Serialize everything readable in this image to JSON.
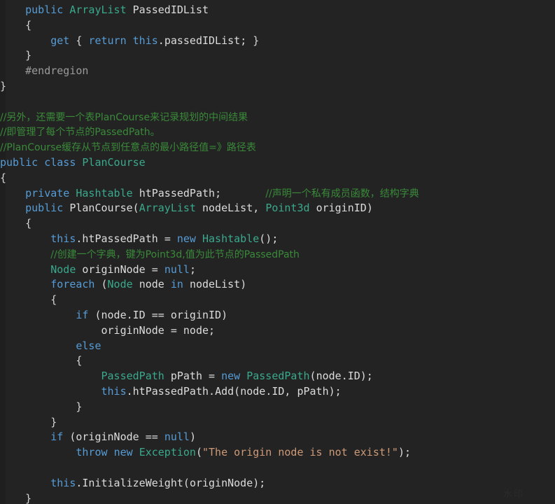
{
  "editor": {
    "background_color": "#232323",
    "gutter_color": "#1f1f1f",
    "default_text_color": "#dcdcdc",
    "language": "C#",
    "watermark": "水印"
  },
  "palette": {
    "keyword": "#569cd6",
    "type": "#3aa98c",
    "identifier": "#dcdcdc",
    "comment": "#3a8a3a",
    "preprocessor": "#9b9b9b",
    "string": "#cd9a78"
  },
  "code": {
    "lines": [
      "    public ArrayList PassedIDList",
      "    {",
      "        get { return this.passedIDList; }",
      "    }",
      "    #endregion",
      "}",
      "",
      "//另外，还需要一个表PlanCourse来记录规划的中间结果",
      "//即管理了每个节点的PassedPath。",
      "//PlanCourse缓存从节点到任意点的最小路径值=》路径表",
      "public class PlanCourse",
      "{",
      "    private Hashtable htPassedPath;      //声明一个私有成员函数，结构字典",
      "    public PlanCourse(ArrayList nodeList, Point3d originID)",
      "    {",
      "        this.htPassedPath = new Hashtable();",
      "        //创建一个字典，键为Point3d,值为此节点的PassedPath",
      "        Node originNode = null;",
      "        foreach (Node node in nodeList)",
      "        {",
      "            if (node.ID == originID)",
      "                originNode = node;",
      "            else",
      "            {",
      "                PassedPath pPath = new PassedPath(node.ID);",
      "                this.htPassedPath.Add(node.ID, pPath);",
      "            }",
      "        }",
      "        if (originNode == null)",
      "            throw new Exception(\"The origin node is not exist!\");",
      "",
      "        this.InitializeWeight(originNode);",
      "    }"
    ],
    "tokens": {
      "keywords": [
        "public",
        "private",
        "class",
        "get",
        "return",
        "this",
        "new",
        "null",
        "foreach",
        "in",
        "if",
        "else",
        "throw"
      ],
      "types": [
        "ArrayList",
        "Hashtable",
        "Node",
        "Point3d",
        "PassedPath",
        "Exception",
        "PlanCourse"
      ],
      "string_literals": [
        "\"The origin node is not exist!\""
      ],
      "preprocessor_directives": [
        "#endregion"
      ],
      "comments": [
        "//另外，还需要一个表PlanCourse来记录规划的中间结果",
        "//即管理了每个节点的PassedPath。",
        "//PlanCourse缓存从节点到任意点的最小路径值=》路径表",
        "//声明一个私有成员函数，结构字典",
        "//创建一个字典，键为Point3d,值为此节点的PassedPath"
      ]
    }
  }
}
